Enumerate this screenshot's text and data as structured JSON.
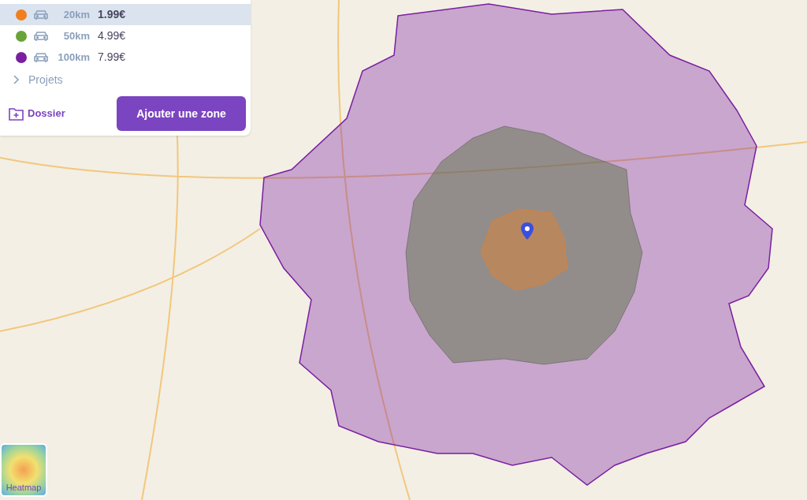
{
  "zones": [
    {
      "color": "#f07f1e",
      "distance": "20km",
      "price": "1.99€",
      "selected": true
    },
    {
      "color": "#6aa33a",
      "distance": "50km",
      "price": "4.99€",
      "selected": false
    },
    {
      "color": "#7a1fa2",
      "distance": "100km",
      "price": "7.99€",
      "selected": false
    }
  ],
  "projects": {
    "label": "Projets",
    "expanded": false
  },
  "folder_button": "Dossier",
  "add_button": "Ajouter une zone",
  "heatmap": {
    "label": "Heatmap"
  }
}
